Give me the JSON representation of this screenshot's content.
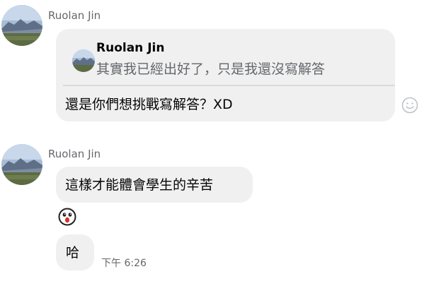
{
  "messages": [
    {
      "sender": "Ruolan Jin",
      "reply": {
        "quoted_sender": "Ruolan Jin",
        "quoted_text": "其實我已經出好了，只是我還沒寫解答",
        "text": "還是你們想挑戰寫解答？XD"
      }
    },
    {
      "sender": "Ruolan Jin",
      "text": "這樣才能體會學生的辛苦",
      "sticker": "shocked-face-sticker",
      "followup_text": "哈",
      "timestamp": "下午 6:26"
    }
  ],
  "icons": {
    "reaction": "smiley-icon",
    "avatar": "landscape-avatar"
  },
  "colors": {
    "bubble": "#f0f0f0",
    "secondary_text": "#65676b",
    "primary_text": "#050505"
  }
}
